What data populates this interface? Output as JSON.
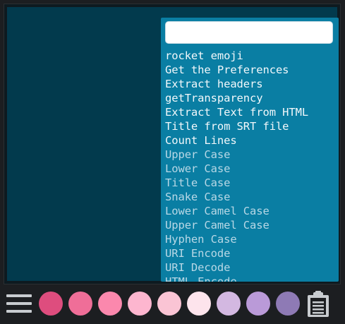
{
  "palette": {
    "search": {
      "value": "",
      "placeholder": ""
    },
    "items": [
      {
        "label": "rocket emoji",
        "kind": "custom"
      },
      {
        "label": "Get the Preferences",
        "kind": "custom"
      },
      {
        "label": "Extract headers",
        "kind": "custom"
      },
      {
        "label": "getTransparency",
        "kind": "custom"
      },
      {
        "label": "Extract Text from HTML",
        "kind": "custom"
      },
      {
        "label": "Title from SRT file",
        "kind": "custom"
      },
      {
        "label": "Count Lines",
        "kind": "custom"
      },
      {
        "label": "Upper Case",
        "kind": "builtin"
      },
      {
        "label": "Lower Case",
        "kind": "builtin"
      },
      {
        "label": "Title Case",
        "kind": "builtin"
      },
      {
        "label": "Snake Case",
        "kind": "builtin"
      },
      {
        "label": "Lower Camel Case",
        "kind": "builtin"
      },
      {
        "label": "Upper Camel Case",
        "kind": "builtin"
      },
      {
        "label": "Hyphen Case",
        "kind": "builtin"
      },
      {
        "label": "URI Encode",
        "kind": "builtin"
      },
      {
        "label": "URI Decode",
        "kind": "builtin"
      },
      {
        "label": "HTML Encode",
        "kind": "builtin"
      }
    ]
  },
  "toolbar": {
    "menu_icon": "hamburger-menu-icon",
    "clipboard_icon": "clipboard-icon",
    "swatches": [
      {
        "color": "#de4d7e"
      },
      {
        "color": "#ef6e98"
      },
      {
        "color": "#fb88ad"
      },
      {
        "color": "#fdb6cf"
      },
      {
        "color": "#fac4d4"
      },
      {
        "color": "#fde4ec"
      },
      {
        "color": "#d3b8e1"
      },
      {
        "color": "#ba9ad8"
      },
      {
        "color": "#8e7ab5"
      }
    ]
  },
  "colors": {
    "editor_background": "#023a4d",
    "palette_background": "#0a7ea3",
    "window_background": "#1c1e21"
  }
}
